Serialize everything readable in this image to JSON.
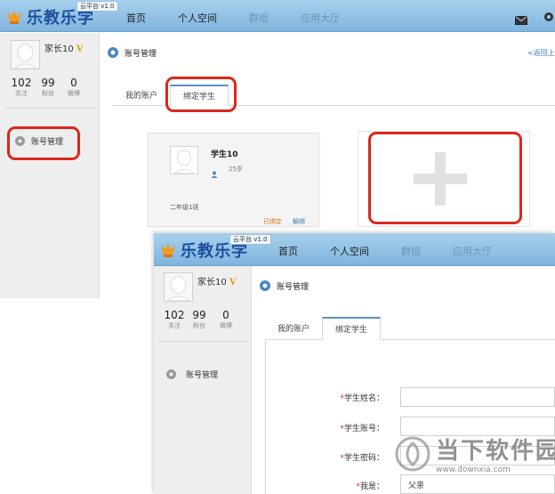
{
  "app": {
    "logo_text": "乐教乐学",
    "version": "云平台 v1.0"
  },
  "nav": {
    "home": "首页",
    "personal": "个人空间",
    "groups": "群组",
    "apps": "应用大厅"
  },
  "user": {
    "name": "家长10",
    "vip_badge": "V"
  },
  "stats": [
    {
      "value": "102",
      "label": "关注"
    },
    {
      "value": "99",
      "label": "粉丝"
    },
    {
      "value": "0",
      "label": "微博"
    }
  ],
  "sidebar": {
    "account_manage": "账号管理"
  },
  "page": {
    "title": "账号管理",
    "back_link": "<返回上一"
  },
  "tabs": {
    "my_account": "我的账户",
    "bind_student": "绑定学生"
  },
  "student_card": {
    "name": "学生10",
    "age": "25岁",
    "grade": "二年级1班",
    "status": "已绑定",
    "unbind": "解绑"
  },
  "form": {
    "student_name_label": "学生姓名：",
    "student_account_label": "学生账号：",
    "student_password_label": "学生密码：",
    "relation_label": "我是：",
    "relation_value": "父亲",
    "required_mark": "*"
  },
  "watermark": {
    "title": "当下软件园",
    "url": "www.downxia.com"
  },
  "colors": {
    "highlight_red": "#d9281d",
    "topbar_blue": "#8fc0e3",
    "brand_blue": "#1d4f9c"
  }
}
